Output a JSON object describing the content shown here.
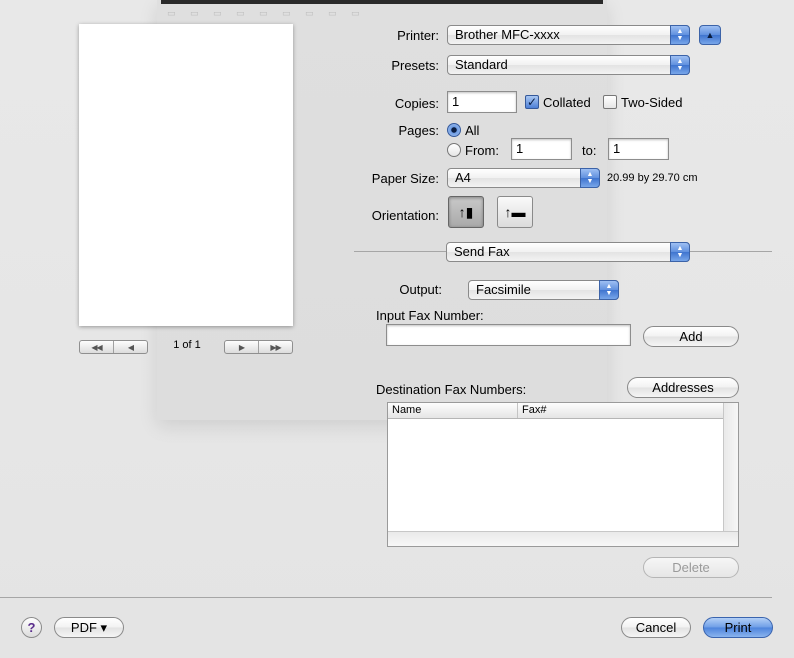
{
  "preview": {
    "page_indicator": "1 of 1",
    "nav_first": "◀◀",
    "nav_prev": "◀",
    "nav_next": "▶",
    "nav_last": "▶▶"
  },
  "printer": {
    "label": "Printer:",
    "value": "Brother MFC-xxxx",
    "disclosure_icon": "triangle-up-icon"
  },
  "presets": {
    "label": "Presets:",
    "value": "Standard"
  },
  "copies": {
    "label": "Copies:",
    "value": "1",
    "collated_label": "Collated",
    "collated_checked": true,
    "two_sided_label": "Two-Sided",
    "two_sided_checked": false
  },
  "pages": {
    "label": "Pages:",
    "all_label": "All",
    "from_label": "From:",
    "from_value": "1",
    "to_label": "to:",
    "to_value": "1",
    "selected": "All"
  },
  "paper_size": {
    "label": "Paper Size:",
    "value": "A4",
    "dimensions": "20.99 by 29.70 cm"
  },
  "orientation": {
    "label": "Orientation:",
    "selected": "portrait"
  },
  "panel_select": {
    "value": "Send Fax"
  },
  "output": {
    "label": "Output:",
    "value": "Facsimile"
  },
  "fax_input": {
    "label": "Input Fax Number:",
    "value": "",
    "add_button": "Add"
  },
  "destination": {
    "label": "Destination Fax Numbers:",
    "addresses_button": "Addresses",
    "columns": [
      "Name",
      "Fax#"
    ],
    "rows": [],
    "delete_button": "Delete"
  },
  "footer": {
    "help": "?",
    "pdf_button": "PDF ▾",
    "cancel_button": "Cancel",
    "print_button": "Print"
  }
}
